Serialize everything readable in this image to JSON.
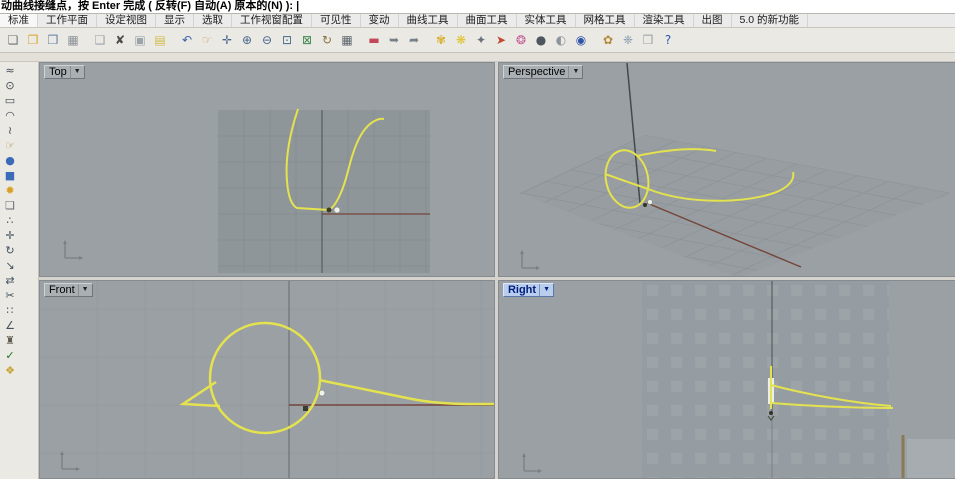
{
  "command_bar": {
    "prompt": "动曲线接缝点，按 Enter 完成 ( 反转(F)  自动(A)  原本的(N) ): |"
  },
  "tabs": {
    "active_index": 0,
    "items": [
      "标准",
      "工作平面",
      "设定视图",
      "显示",
      "选取",
      "工作视窗配置",
      "可见性",
      "变动",
      "曲线工具",
      "曲面工具",
      "实体工具",
      "网格工具",
      "渲染工具",
      "出图",
      "5.0 的新功能"
    ]
  },
  "toolbar": {
    "icons": [
      {
        "name": "new-file-icon",
        "glyph": "❏",
        "color": "#6d7378"
      },
      {
        "name": "open-folder-icon",
        "glyph": "❐",
        "color": "#d9a62e"
      },
      {
        "name": "save-icon",
        "glyph": "❒",
        "color": "#5f7fa8"
      },
      {
        "name": "print-icon",
        "glyph": "▦",
        "color": "#8b9299"
      },
      {
        "name": "export-page-icon",
        "glyph": "❑",
        "color": "#9aa2aa",
        "gap": true
      },
      {
        "name": "delete-icon",
        "glyph": "✘",
        "color": "#4a4a4a"
      },
      {
        "name": "copy-icon",
        "glyph": "▣",
        "color": "#9aa2aa"
      },
      {
        "name": "paste-icon",
        "glyph": "▤",
        "color": "#d2b94a"
      },
      {
        "name": "undo-icon",
        "glyph": "↶",
        "color": "#3a62a8",
        "gap": true
      },
      {
        "name": "pan-hand-icon",
        "glyph": "☞",
        "color": "#c49a5e"
      },
      {
        "name": "zoom-dynamic-icon",
        "glyph": "✛",
        "color": "#47688e"
      },
      {
        "name": "zoom-in-icon",
        "glyph": "⊕",
        "color": "#47688e"
      },
      {
        "name": "zoom-out-icon",
        "glyph": "⊖",
        "color": "#47688e"
      },
      {
        "name": "zoom-window-icon",
        "glyph": "⊡",
        "color": "#47688e"
      },
      {
        "name": "zoom-extents-icon",
        "glyph": "⊠",
        "color": "#3f8a4f"
      },
      {
        "name": "rotate-view-icon",
        "glyph": "↻",
        "color": "#8a7340"
      },
      {
        "name": "viewport-layout-icon",
        "glyph": "▦",
        "color": "#5c666e"
      },
      {
        "name": "hide-objects-icon",
        "glyph": "▬",
        "color": "#c2485a",
        "gap": true
      },
      {
        "name": "view-undo-icon",
        "glyph": "➥",
        "color": "#76818a"
      },
      {
        "name": "view-redo-icon",
        "glyph": "➦",
        "color": "#76818a"
      },
      {
        "name": "lamp-icon",
        "glyph": "✾",
        "color": "#d9b02e",
        "gap": true
      },
      {
        "name": "bulb-on-icon",
        "glyph": "❋",
        "color": "#e0c22e"
      },
      {
        "name": "lock-icon",
        "glyph": "✦",
        "color": "#6b747c"
      },
      {
        "name": "render-cone-icon",
        "glyph": "➤",
        "color": "#bf4b2e"
      },
      {
        "name": "color-wheel-icon",
        "glyph": "❂",
        "color": "#c25a96"
      },
      {
        "name": "shaded-sphere-icon",
        "glyph": "●",
        "color": "#4d565e"
      },
      {
        "name": "xray-sphere-icon",
        "glyph": "◐",
        "color": "#8d959c"
      },
      {
        "name": "render-sphere-icon",
        "glyph": "◉",
        "color": "#2f55a8"
      },
      {
        "name": "material-icon",
        "glyph": "✿",
        "color": "#b5893a",
        "gap": true
      },
      {
        "name": "snapshot-icon",
        "glyph": "❈",
        "color": "#7d93ad"
      },
      {
        "name": "cascade-windows-icon",
        "glyph": "❒",
        "color": "#98a0a8"
      },
      {
        "name": "help-icon",
        "glyph": "?",
        "color": "#2b57b0"
      }
    ]
  },
  "sidebar": {
    "icons": [
      {
        "name": "control-points-icon",
        "glyph": "≈",
        "color": "#404a54"
      },
      {
        "name": "point-icon",
        "glyph": "⊙",
        "color": "#404a54"
      },
      {
        "name": "rectangle-icon",
        "glyph": "▭",
        "color": "#404a54"
      },
      {
        "name": "arc-icon",
        "glyph": "◠",
        "color": "#404a54"
      },
      {
        "name": "curve-icon",
        "glyph": "≀",
        "color": "#404a54"
      },
      {
        "name": "pan-hand-icon",
        "glyph": "☞",
        "color": "#b08a50"
      },
      {
        "name": "sphere-icon",
        "glyph": "●",
        "color": "#3a6ab8"
      },
      {
        "name": "solid-box-icon",
        "glyph": "■",
        "color": "#3a6ab8"
      },
      {
        "name": "explode-icon",
        "glyph": "✹",
        "color": "#d8a020"
      },
      {
        "name": "stack-icon",
        "glyph": "❏",
        "color": "#606870"
      },
      {
        "name": "curve-points-icon",
        "glyph": "∴",
        "color": "#404a54"
      },
      {
        "name": "move-icon",
        "glyph": "✛",
        "color": "#405060"
      },
      {
        "name": "rotate-icon",
        "glyph": "↻",
        "color": "#405060"
      },
      {
        "name": "scale-icon",
        "glyph": "↘",
        "color": "#405060"
      },
      {
        "name": "mirror-icon",
        "glyph": "⇄",
        "color": "#405060"
      },
      {
        "name": "trim-icon",
        "glyph": "✂",
        "color": "#405060"
      },
      {
        "name": "array-icon",
        "glyph": "∷",
        "color": "#405060"
      },
      {
        "name": "angle-icon",
        "glyph": "∠",
        "color": "#405060"
      },
      {
        "name": "tower-icon",
        "glyph": "♜",
        "color": "#605a50"
      },
      {
        "name": "check-icon",
        "glyph": "✓",
        "color": "#207020"
      },
      {
        "name": "paint-bucket-icon",
        "glyph": "❖",
        "color": "#c8a030"
      }
    ]
  },
  "viewports": {
    "top": {
      "title": "Top"
    },
    "perspective": {
      "title": "Perspective"
    },
    "front": {
      "title": "Front"
    },
    "right": {
      "title": "Right",
      "active": true
    }
  },
  "ui": {
    "menu_arrow": "▼"
  },
  "colors": {
    "curve_yellow": "#e4e24e",
    "axis_red": "#74443a",
    "axis_dark": "#565e60",
    "viewport_bg": "#9aa0a4",
    "grid_patch": "#8f969a",
    "grid_line": "#868d91",
    "active_title_bg": "#b9cdec",
    "active_title_text": "#001f7e"
  }
}
